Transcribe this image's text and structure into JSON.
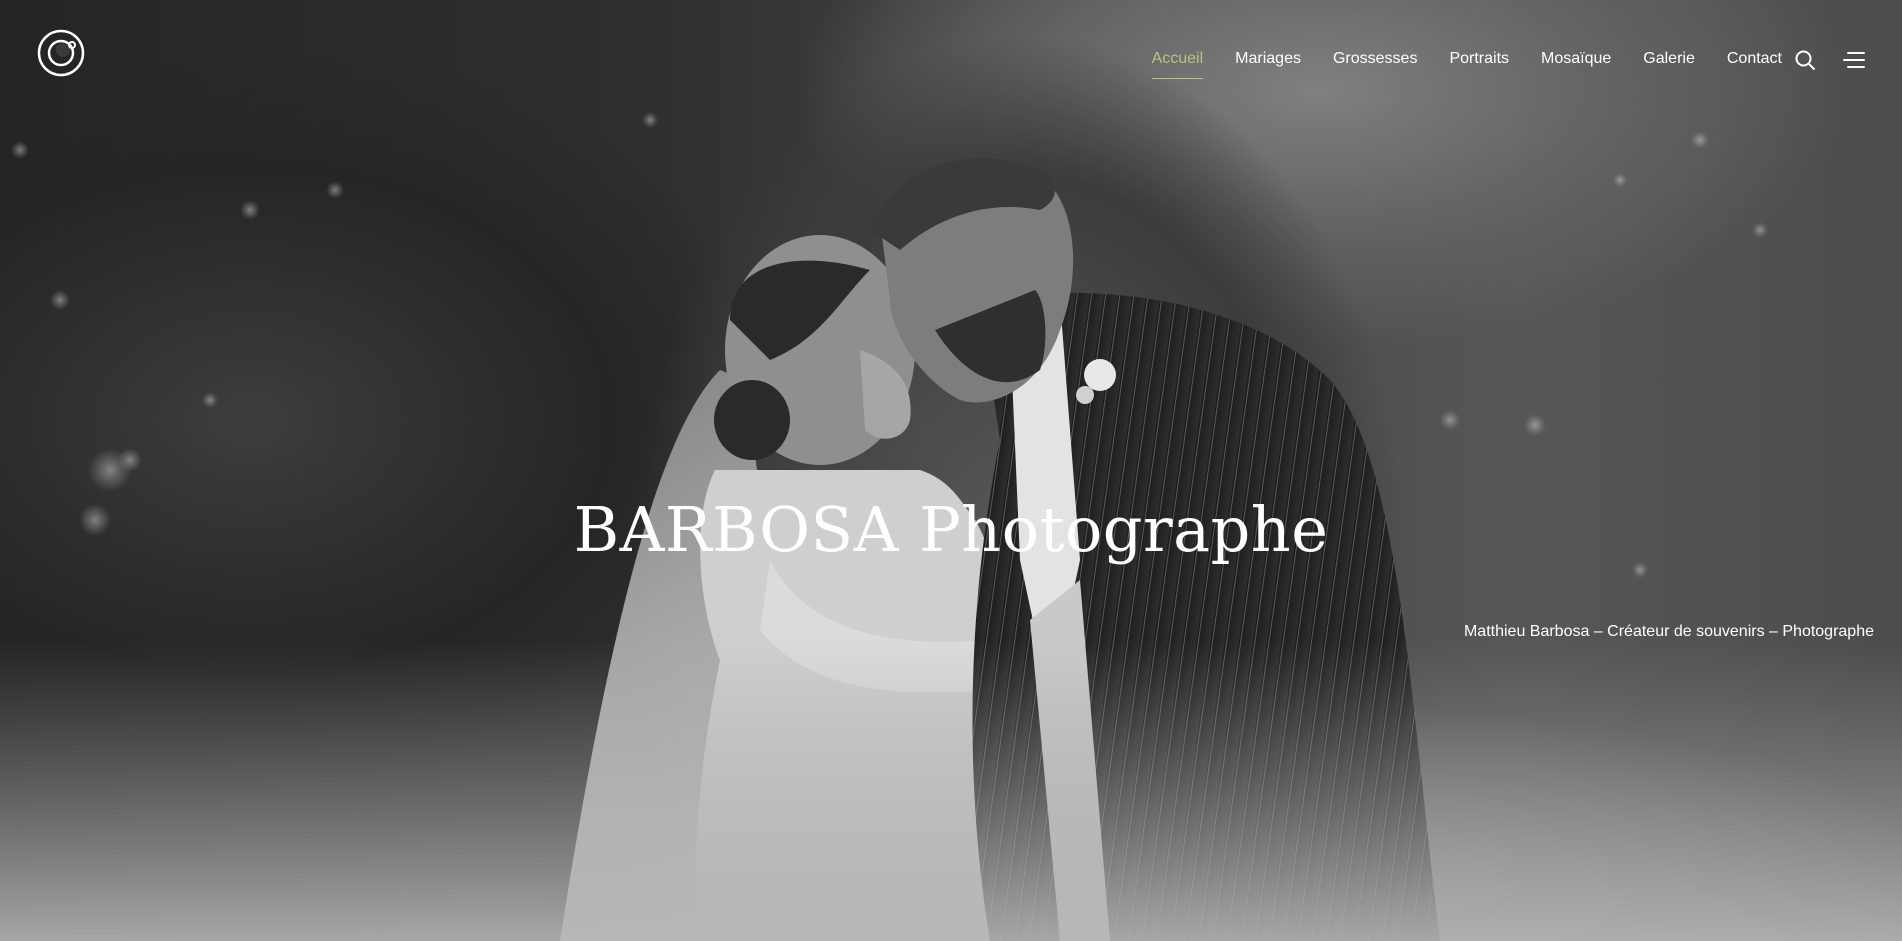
{
  "header": {
    "logo_icon": "camera-lens-icon",
    "nav": [
      {
        "label": "Accueil",
        "active": true
      },
      {
        "label": "Mariages",
        "active": false
      },
      {
        "label": "Grossesses",
        "active": false
      },
      {
        "label": "Portraits",
        "active": false
      },
      {
        "label": "Mosaïque",
        "active": false
      },
      {
        "label": "Galerie",
        "active": false
      },
      {
        "label": "Contact",
        "active": false
      }
    ],
    "search_icon": "search-icon",
    "menu_icon": "hamburger-menu-icon"
  },
  "hero": {
    "title": "BARBOSA Photographe",
    "subtitle": "Matthieu Barbosa – Créateur de souvenirs – Photographe",
    "image_description_icon": "wedding-couple-photo"
  },
  "colors": {
    "accent": "#b9c27a",
    "text": "#ffffff"
  }
}
